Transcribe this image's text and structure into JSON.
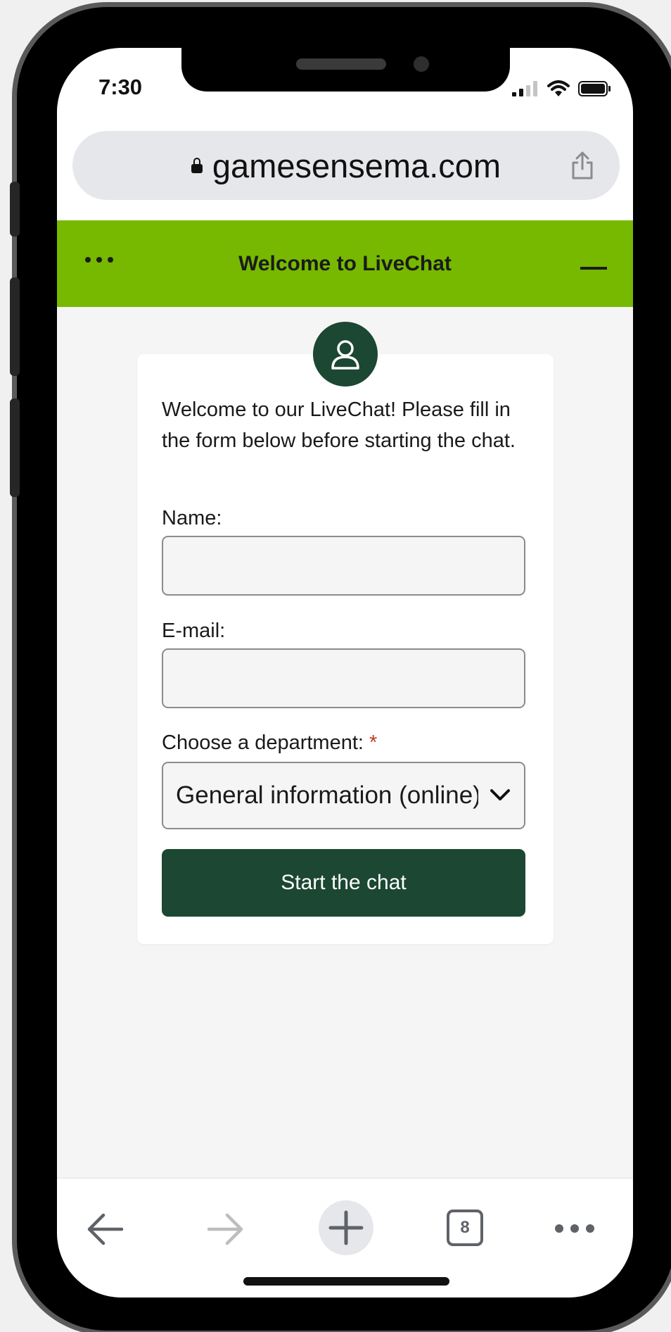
{
  "status_bar": {
    "time": "7:30",
    "icons": [
      "signal-icon",
      "wifi-icon",
      "battery-icon"
    ]
  },
  "browser": {
    "url": "gamesensema.com",
    "tab_count": "8",
    "icons": [
      "lock-icon",
      "share-icon",
      "back-arrow-icon",
      "forward-arrow-icon",
      "new-tab-plus-icon",
      "tabs-icon",
      "more-icon"
    ]
  },
  "chat_header": {
    "title": "Welcome to LiveChat",
    "icons": [
      "menu-dots-icon",
      "minimize-icon"
    ]
  },
  "form": {
    "intro": "Welcome to our LiveChat! Please fill in the form below before starting the chat.",
    "name_label": "Name:",
    "name_value": "",
    "email_label": "E-mail:",
    "email_value": "",
    "department_label": "Choose a department:",
    "required_marker": "*",
    "department_selected": "General information (online)",
    "submit_label": "Start the chat",
    "icons": [
      "user-avatar-icon",
      "chevron-down-icon"
    ]
  },
  "colors": {
    "header_green": "#76b900",
    "dark_green": "#1b4733",
    "required_red": "#c0392b"
  }
}
